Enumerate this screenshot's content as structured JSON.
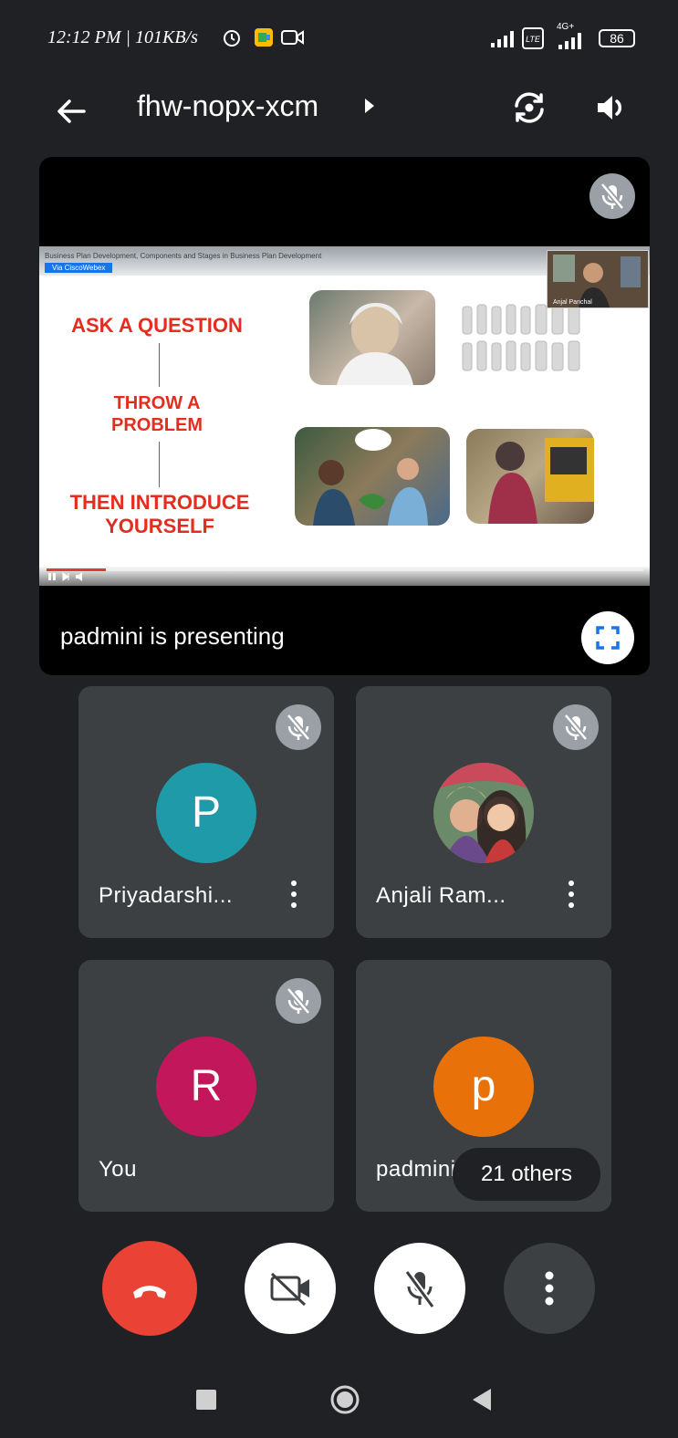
{
  "status_bar": {
    "time": "12:12 PM | 101KB/s",
    "network": "4G+",
    "battery": "86"
  },
  "header": {
    "back_icon": "arrow-left-icon",
    "meeting_code": "fhw-nopx-xcm",
    "switch_camera_icon": "switch-camera-icon",
    "speaker_icon": "speaker-icon"
  },
  "presentation": {
    "slide_caption": "Business Plan Development, Components and Stages in Business Plan Development",
    "slide_badge": "Via CiscoWebex",
    "slide_q1": "ASK A QUESTION",
    "slide_q2_line1": "THROW A",
    "slide_q2_line2": "PROBLEM",
    "slide_q3_line1": "THEN INTRODUCE",
    "slide_q3_line2": "YOURSELF",
    "pip_name": "Anjal Panchal",
    "presenting_label": "padmini is presenting",
    "progress": 0.1
  },
  "tiles": [
    {
      "name": "Priyadarshi...",
      "initial": "P",
      "color": "#1e9aa9",
      "muted": true
    },
    {
      "name": "Anjali Ram...",
      "initial": "",
      "color": "#6d4c41",
      "muted": true
    },
    {
      "name": "You",
      "initial": "R",
      "color": "#c2185b",
      "muted": true
    },
    {
      "name": "padmini",
      "initial": "p",
      "color": "#e8710a",
      "muted": false,
      "others_chip": "21 others"
    }
  ],
  "controls": {
    "end_call_color": "#ea4335"
  }
}
